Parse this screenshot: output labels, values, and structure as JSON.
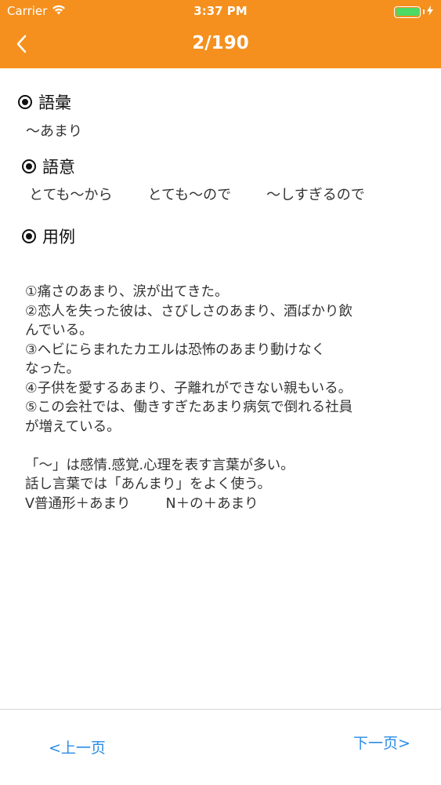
{
  "status_bar": {
    "carrier": "Carrier",
    "time": "3:37 PM",
    "battery_percent": 100
  },
  "nav": {
    "title": "2/190",
    "back_icon": "chevron-left-icon"
  },
  "colors": {
    "header": "#f5901e",
    "link": "#2a8be6",
    "battery": "#4cd964"
  },
  "vocab_section": {
    "heading": "語彙",
    "word": "～あまり"
  },
  "meaning_section": {
    "heading": "語意",
    "items": [
      "とても～から",
      "とても～ので",
      "～しすぎるので"
    ]
  },
  "example_section": {
    "heading": "用例",
    "lines": [
      "①痛さのあまり、涙が出てきた。",
      "②恋人を失った彼は、さびしさのあまり、酒ばかり飲",
      "んでいる。",
      "③ヘビにらまれたカエルは恐怖のあまり動けなく",
      "なった。",
      "④子供を愛するあまり、子離れができない親もいる。",
      "⑤この会社では、働きすぎたあまり病気で倒れる社員",
      "が増えている。"
    ],
    "notes": [
      "「～」は感情.感覚.心理を表す言葉が多い。",
      "話し言葉では「あんまり」をよく使う。"
    ],
    "pattern": [
      "V普通形＋あまり",
      "N＋の＋あまり"
    ]
  },
  "footer": {
    "prev_label": "<上一页",
    "next_label": "下一页>"
  }
}
